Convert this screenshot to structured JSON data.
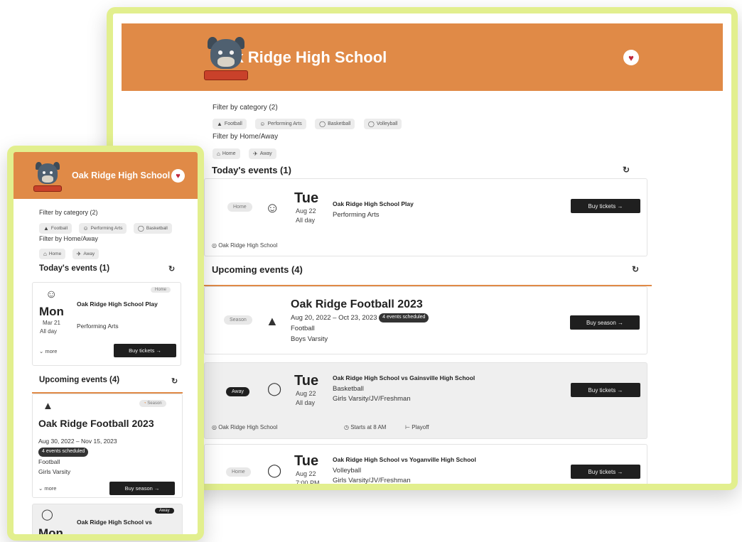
{
  "school": "Oak Ridge High School",
  "heart_icon": "heart-icon",
  "desktop": {
    "filter_category_label": "Filter by category (2)",
    "categories": [
      "Football",
      "Performing Arts",
      "Basketball",
      "Volleyball"
    ],
    "filter_homeaway_label": "Filter by Home/Away",
    "homeaway": [
      "Home",
      "Away"
    ],
    "today_title": "Today's events (1)",
    "today_event": {
      "tag": "Home",
      "day": "Tue",
      "date": "Aug 22",
      "time": "All day",
      "title": "Oak Ridge High School Play",
      "category": "Performing Arts",
      "location": "Oak Ridge High School",
      "button": "Buy tickets →"
    },
    "upcoming_title": "Upcoming events (4)",
    "season_event": {
      "tag": "Season",
      "title": "Oak Ridge Football 2023",
      "dates": "Aug 20, 2022 – Oct 23, 2023",
      "badge": "4 events scheduled",
      "category": "Football",
      "team": "Boys Varsity",
      "button": "Buy season →"
    },
    "away_event": {
      "tag": "Away",
      "day": "Tue",
      "date": "Aug 22",
      "time": "All day",
      "title": "Oak Ridge High School vs Gainsville High School",
      "category": "Basketball",
      "team": "Girls Varsity/JV/Freshman",
      "location": "Oak Ridge High School",
      "start": "Starts at 8 AM",
      "playoff": "Playoff",
      "button": "Buy tickets →"
    },
    "home_event": {
      "tag": "Home",
      "day": "Tue",
      "date": "Aug 22",
      "time": "7:00 PM",
      "title": "Oak Ridge High School vs Yoganville High School",
      "category": "Volleyball",
      "team": "Girls Varsity/JV/Freshman",
      "button": "Buy tickets →"
    }
  },
  "mobile": {
    "filter_category_label": "Filter by category (2)",
    "categories": [
      "Football",
      "Performing Arts",
      "Basketball"
    ],
    "filter_homeaway_label": "Filter by Home/Away",
    "homeaway": [
      "Home",
      "Away"
    ],
    "today_title": "Today's events (1)",
    "today_event": {
      "tag": "Home",
      "day": "Mon",
      "date": "Mar 21",
      "time": "All day",
      "title": "Oak Ridge High School Play",
      "category": "Performing Arts",
      "more": "more",
      "button": "Buy tickets →"
    },
    "upcoming_title": "Upcoming events (4)",
    "season_event": {
      "tag": "Season",
      "title": "Oak Ridge Football 2023",
      "dates": "Aug 30, 2022 – Nov 15, 2023",
      "badge": "4 events scheduled",
      "category": "Football",
      "team": "Girls Varsity",
      "more": "more",
      "button": "Buy season →"
    },
    "next_event": {
      "tag": "Away",
      "day": "Mon",
      "title": "Oak Ridge High School vs"
    }
  },
  "colors": {
    "header": "#e08a47",
    "frame": "#e2ef8e",
    "button": "#1f1f1f"
  }
}
